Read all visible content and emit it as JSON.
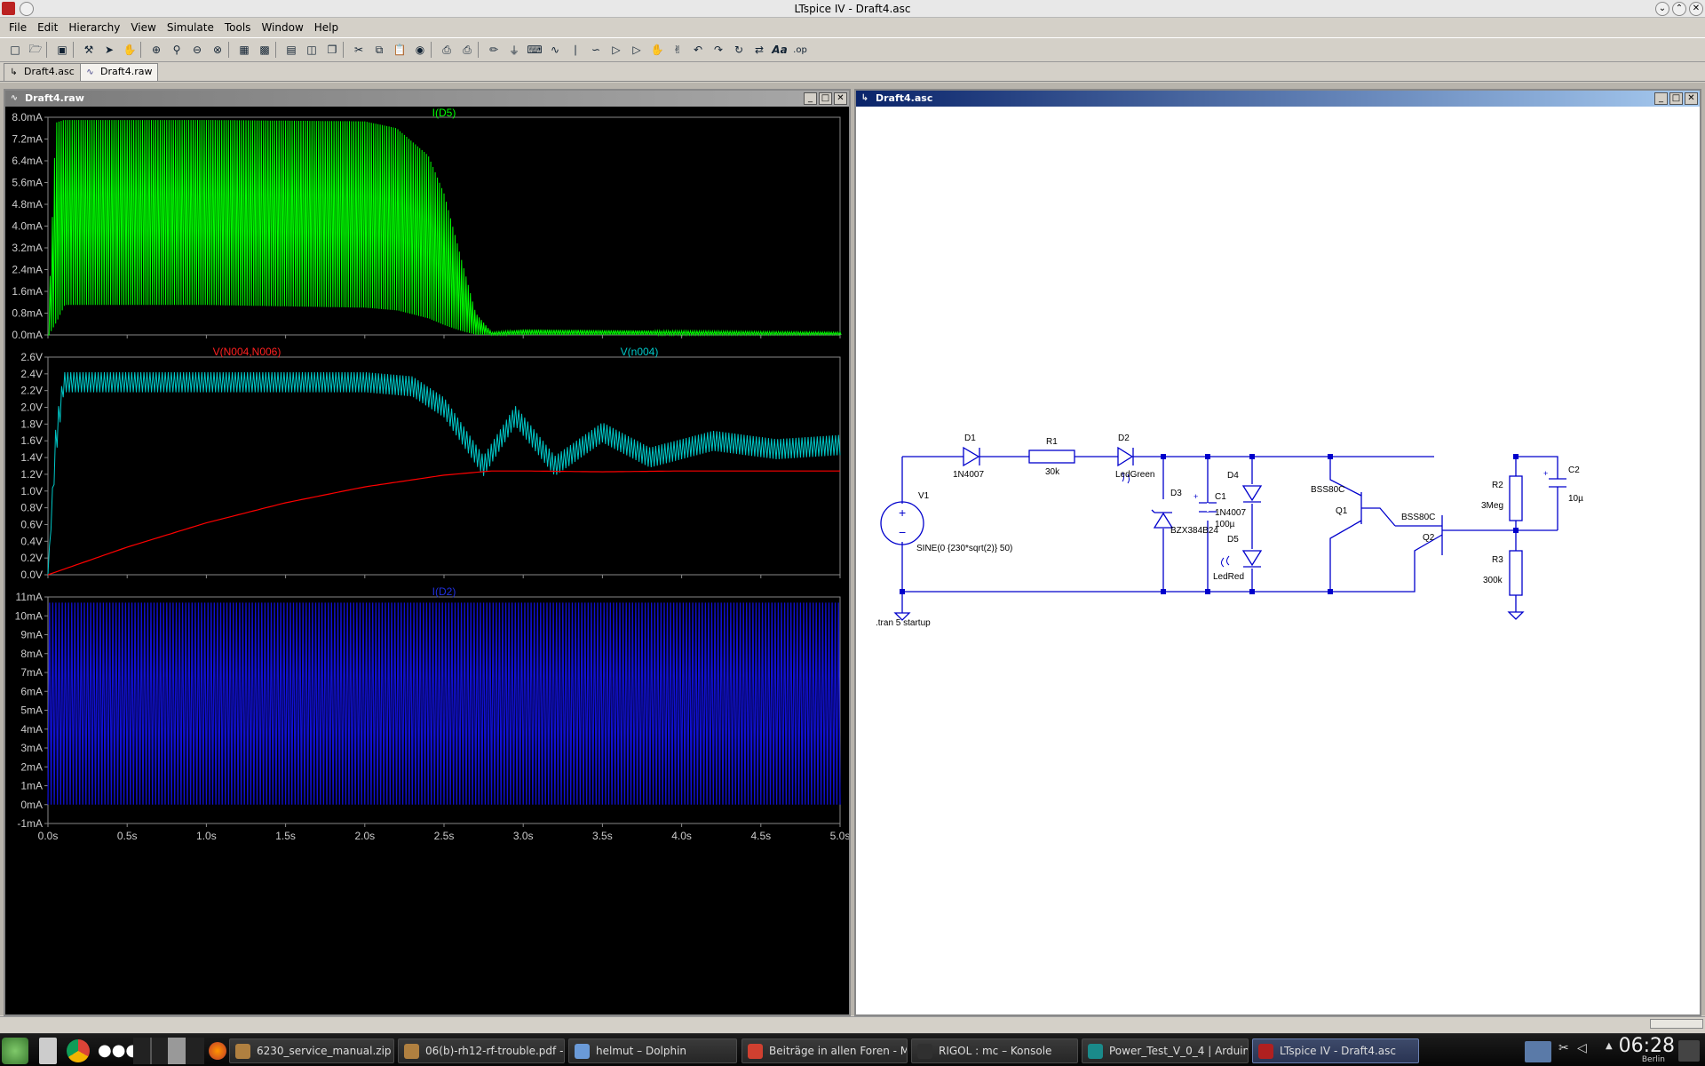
{
  "window": {
    "title": "LTspice IV - Draft4.asc"
  },
  "menu": [
    "File",
    "Edit",
    "Hierarchy",
    "View",
    "Simulate",
    "Tools",
    "Window",
    "Help"
  ],
  "toolbar_icons": [
    "new-schematic-icon",
    "open-icon",
    "save-icon",
    "control-panel-icon",
    "run-icon",
    "halt-icon",
    "zoom-in-icon",
    "zoom-area-icon",
    "zoom-out-icon",
    "zoom-fit-icon",
    "autorange-icon",
    "grid-icon",
    "tile-horizontal-icon",
    "tile-vertical-icon",
    "cascade-icon",
    "cut-icon",
    "copy-icon",
    "paste-icon",
    "find-icon",
    "print-preview-icon",
    "print-icon",
    "draw-wire-icon",
    "ground-icon",
    "label-net-icon",
    "resistor-icon",
    "capacitor-icon",
    "inductor-icon",
    "diode-icon",
    "component-icon",
    "move-icon",
    "drag-icon",
    "undo-icon",
    "redo-icon",
    "rotate-icon",
    "mirror-icon",
    "text-icon",
    "spice-directive-icon"
  ],
  "tabs": [
    {
      "label": "Draft4.asc",
      "icon": "schematic-tab-icon"
    },
    {
      "label": "Draft4.raw",
      "icon": "waveform-tab-icon"
    }
  ],
  "waveform_window": {
    "title": "Draft4.raw"
  },
  "schematic_window": {
    "title": "Draft4.asc"
  },
  "chart_data": [
    {
      "type": "line",
      "title": "I(D5)",
      "series": [
        {
          "name": "I(D5)",
          "color": "#00ff00",
          "shape": "oscillating current, envelope 1.1mA-7.9mA until ~2.3s then decaying to ~0 by 2.7s"
        }
      ],
      "y_ticks": [
        "8.0mA",
        "7.2mA",
        "6.4mA",
        "5.6mA",
        "4.8mA",
        "4.0mA",
        "3.2mA",
        "2.4mA",
        "1.6mA",
        "0.8mA",
        "0.0mA"
      ],
      "ylim": [
        0,
        8.0
      ],
      "xlim": [
        0,
        5.0
      ],
      "envelope": {
        "x": [
          0,
          0.05,
          0.1,
          1.0,
          2.0,
          2.2,
          2.4,
          2.5,
          2.6,
          2.7,
          2.8,
          3.0,
          5.0
        ],
        "upper": [
          0,
          7.8,
          7.9,
          7.9,
          7.85,
          7.6,
          6.6,
          5.2,
          3.0,
          0.8,
          0.1,
          0.2,
          0.1
        ],
        "lower": [
          0,
          0.5,
          1.1,
          1.1,
          1.0,
          0.9,
          0.6,
          0.35,
          0.15,
          0.0,
          0.0,
          0.0,
          0.0
        ]
      }
    },
    {
      "type": "line",
      "title": "V(N004,N006) / V(n004)",
      "series": [
        {
          "name": "V(N004,N006)",
          "color": "#ff0000",
          "x": [
            0,
            0.5,
            1.0,
            1.5,
            2.0,
            2.5,
            2.8,
            3.0,
            3.5,
            4.0,
            4.5,
            5.0
          ],
          "y": [
            0,
            0.33,
            0.62,
            0.86,
            1.05,
            1.19,
            1.24,
            1.24,
            1.23,
            1.24,
            1.24,
            1.24
          ]
        },
        {
          "name": "V(n004)",
          "color": "#00c8c8",
          "x": [
            0,
            0.05,
            0.1,
            1.0,
            2.0,
            2.3,
            2.5,
            2.75,
            2.95,
            3.2,
            3.5,
            3.8,
            4.2,
            4.6,
            5.0
          ],
          "y": [
            0,
            1.6,
            2.3,
            2.3,
            2.3,
            2.25,
            2.0,
            1.3,
            1.9,
            1.3,
            1.7,
            1.4,
            1.6,
            1.5,
            1.55
          ],
          "amplitude": [
            0,
            0.2,
            0.12,
            0.12,
            0.12,
            0.12,
            0.12,
            0.12,
            0.12,
            0.12,
            0.12,
            0.12,
            0.12,
            0.12,
            0.12
          ]
        }
      ],
      "y_ticks": [
        "2.6V",
        "2.4V",
        "2.2V",
        "2.0V",
        "1.8V",
        "1.6V",
        "1.4V",
        "1.2V",
        "1.0V",
        "0.8V",
        "0.6V",
        "0.4V",
        "0.2V",
        "0.0V"
      ],
      "ylim": [
        0,
        2.6
      ],
      "xlim": [
        0,
        5.0
      ]
    },
    {
      "type": "line",
      "title": "I(D2)",
      "series": [
        {
          "name": "I(D2)",
          "color": "#1010d0",
          "shape": "dense oscillation between 0mA and 10.7mA across full time range"
        }
      ],
      "y_ticks": [
        "11mA",
        "10mA",
        "9mA",
        "8mA",
        "7mA",
        "6mA",
        "5mA",
        "4mA",
        "3mA",
        "2mA",
        "1mA",
        "0mA",
        "-1mA"
      ],
      "ylim": [
        -1,
        11
      ],
      "xlim": [
        0,
        5.0
      ],
      "x_ticks": [
        "0.0s",
        "0.5s",
        "1.0s",
        "1.5s",
        "2.0s",
        "2.5s",
        "3.0s",
        "3.5s",
        "4.0s",
        "4.5s",
        "5.0s"
      ]
    }
  ],
  "schematic": {
    "labels": {
      "D1": "D1",
      "D1_model": "1N4007",
      "R1": "R1",
      "R1_value": "30k",
      "D2": "D2",
      "D2_model": "LedGreen",
      "D3": "D3",
      "D3_model": "BZX384B24",
      "C1": "C1",
      "C1_value": "100µ",
      "D4": "D4",
      "D4_model": "1N4007",
      "D5": "D5",
      "D5_model": "LedRed",
      "Q1": "Q1",
      "Q1_model": "BSS80C",
      "Q2": "Q2",
      "Q2_model": "BSS80C",
      "R2": "R2",
      "R2_value": "3Meg",
      "R3": "R3",
      "R3_value": "300k",
      "C2": "C2",
      "C2_value": "10µ",
      "V1": "V1",
      "V1_value": "SINE(0 {230*sqrt(2)} 50)",
      "directive": ".tran 5 startup"
    }
  },
  "taskbar": {
    "tasks": [
      {
        "label": "6230_service_manual.zip -",
        "color": "#b08040"
      },
      {
        "label": "06(b)-rh12-rf-trouble.pdf - A",
        "color": "#b08040"
      },
      {
        "label": "helmut – Dolphin",
        "color": "#6a9ad8"
      },
      {
        "label": "Beiträge in allen Foren - Mi",
        "color": "#d04030"
      },
      {
        "label": "RIGOL : mc – Konsole",
        "color": "#303030"
      },
      {
        "label": "Power_Test_V_0_4 | Arduin",
        "color": "#1a8a8a"
      },
      {
        "label": "LTspice IV - Draft4.asc",
        "color": "#b02020"
      }
    ],
    "clock": "06:28",
    "clock_sub": "Berlin"
  }
}
